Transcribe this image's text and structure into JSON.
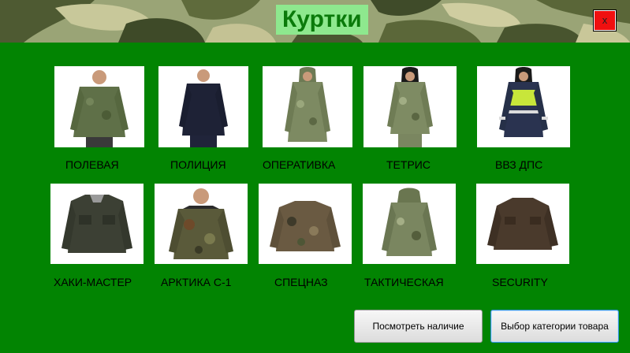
{
  "window": {
    "title": "Куртки",
    "close_label": "x"
  },
  "products": [
    {
      "label": "ПОЛЕВАЯ",
      "image": "jacket-camo-photo"
    },
    {
      "label": "ПОЛИЦИЯ",
      "image": "jacket-police-photo"
    },
    {
      "label": "ОПЕРАТИВКА",
      "image": "jacket-hooded-camo-photo"
    },
    {
      "label": "ТЕТРИС",
      "image": "jacket-hooded-camo-photo"
    },
    {
      "label": "ВВЗ ДПС",
      "image": "jacket-reflective-photo"
    },
    {
      "label": "ХАКИ-МАСТЕР",
      "image": "jacket-khaki-photo"
    },
    {
      "label": "АРКТИКА С-1",
      "image": "jacket-winter-camo-photo"
    },
    {
      "label": "СПЕЦНАЗ",
      "image": "jacket-camo-photo"
    },
    {
      "label": "ТАКТИЧЕСКАЯ",
      "image": "jacket-tactical-photo"
    },
    {
      "label": "SECURITY",
      "image": "jacket-brown-photo"
    }
  ],
  "buttons": {
    "check_stock": "Посмотреть наличие",
    "choose_category": "Выбор категории товара"
  },
  "colors": {
    "background": "#028402",
    "title_bg": "#8ee88e",
    "close_bg": "#f01010"
  }
}
